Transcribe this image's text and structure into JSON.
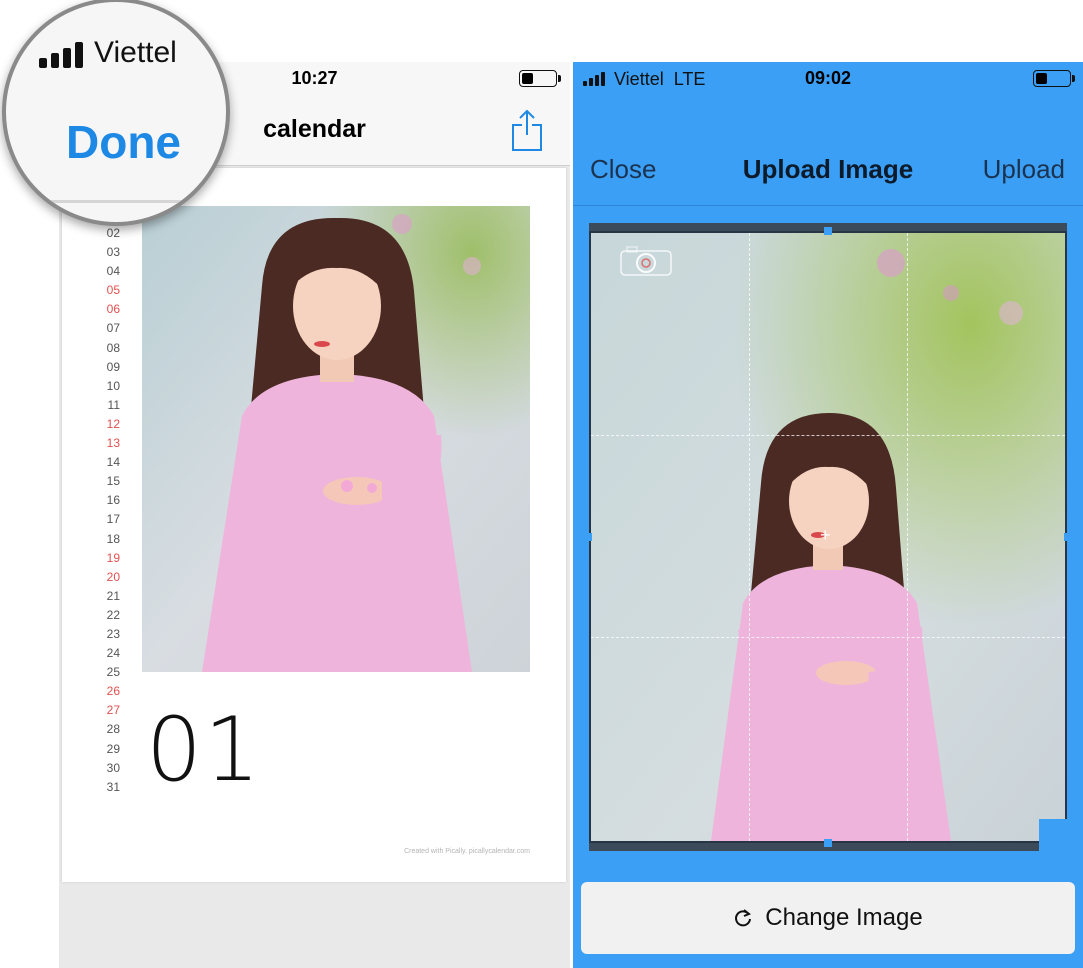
{
  "left_panel": {
    "status": {
      "carrier": "Viettel",
      "time": "10:27"
    },
    "nav": {
      "done_label": "Done",
      "title": "calendar",
      "share_icon": "share-icon"
    },
    "calendar": {
      "days": [
        {
          "label": "02",
          "weekend": false
        },
        {
          "label": "03",
          "weekend": false
        },
        {
          "label": "04",
          "weekend": false
        },
        {
          "label": "05",
          "weekend": true
        },
        {
          "label": "06",
          "weekend": true
        },
        {
          "label": "07",
          "weekend": false
        },
        {
          "label": "08",
          "weekend": false
        },
        {
          "label": "09",
          "weekend": false
        },
        {
          "label": "10",
          "weekend": false
        },
        {
          "label": "11",
          "weekend": false
        },
        {
          "label": "12",
          "weekend": true
        },
        {
          "label": "13",
          "weekend": true
        },
        {
          "label": "14",
          "weekend": false
        },
        {
          "label": "15",
          "weekend": false
        },
        {
          "label": "16",
          "weekend": false
        },
        {
          "label": "17",
          "weekend": false
        },
        {
          "label": "18",
          "weekend": false
        },
        {
          "label": "19",
          "weekend": true
        },
        {
          "label": "20",
          "weekend": true
        },
        {
          "label": "21",
          "weekend": false
        },
        {
          "label": "22",
          "weekend": false
        },
        {
          "label": "23",
          "weekend": false
        },
        {
          "label": "24",
          "weekend": false
        },
        {
          "label": "25",
          "weekend": false
        },
        {
          "label": "26",
          "weekend": true
        },
        {
          "label": "27",
          "weekend": true
        },
        {
          "label": "28",
          "weekend": false
        },
        {
          "label": "29",
          "weekend": false
        },
        {
          "label": "30",
          "weekend": false
        },
        {
          "label": "31",
          "weekend": false
        }
      ],
      "month_number": "01",
      "credit": "Created with Pically. picallycalendar.com"
    }
  },
  "right_panel": {
    "status": {
      "carrier": "Viettel",
      "network": "LTE",
      "time": "09:02"
    },
    "nav": {
      "close_label": "Close",
      "title": "Upload Image",
      "upload_label": "Upload"
    },
    "change_image_label": "Change Image"
  },
  "colors": {
    "accent": "#3a9ff5",
    "done_blue": "#1e88e5",
    "weekend_red": "#e25050"
  }
}
